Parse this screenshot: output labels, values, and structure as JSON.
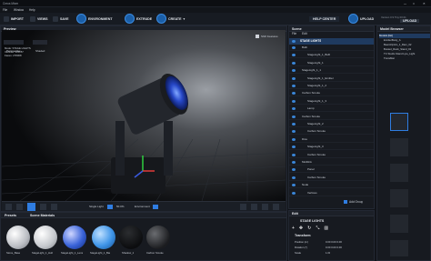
{
  "window": {
    "title": "Creos Mixer",
    "min": "—",
    "max": "□",
    "close": "✕"
  },
  "menu": [
    "File",
    "Window",
    "Help"
  ],
  "toolbar": {
    "import": "IMPORT",
    "views": "VIEWS",
    "save": "SAVE",
    "environment": "ENVIRONMENT",
    "extrude": "EXTRUDE",
    "create": "CREATE",
    "help_center": "HELP CENTER",
    "version": "Version 0.9 Tiny 00.01",
    "user": "UPLOAD",
    "upload": "UPLOAD"
  },
  "preview": {
    "title": "Preview",
    "perspective": "Perspective",
    "shaded": "Shaded",
    "stats": [
      "Mode: STAGE LIGHTS",
      "Vertices: 335157",
      "Faces: 278308"
    ],
    "shift_features": "Shift Features",
    "single_light": "Single Light",
    "percent": "50.0%",
    "environment": "Environment"
  },
  "scene": {
    "title": "Scene",
    "tabs": [
      "File",
      "Edit"
    ],
    "root": "STAGE LIGHTS",
    "items": [
      "Bulb",
      "StageLight_1_Bulb",
      "StageLight_1",
      "StageLight_1_1",
      "StageLight_1_Emitter",
      "StageLight_1_2",
      "Carbon Smoke",
      "StageLight_1_3",
      "Lamp",
      "Carbon Smoke",
      "StageLight_2",
      "Carbon Smoke",
      "Dice",
      "StageLight_3",
      "Carbon Smoke",
      "Multilink",
      "Panel",
      "Carbon Smoke",
      "Node",
      "Vertices"
    ],
    "add_group": "Add Group"
  },
  "model_browser": {
    "title": "Model Browser",
    "items": [
      "Models [list]",
      "EmitterBody_A",
      "BeamOptics_1_Ram_02",
      "Busted_Rack_Stand_02",
      "TC Studio Stand Lyre_Light",
      "TransMat"
    ]
  },
  "bottom": {
    "presets": "Presets",
    "materials": "Scene Materials",
    "swatches": [
      "Stone_Base",
      "StageLight_1_Hull",
      "StageLight_1_Lens",
      "StageLight_1_Bar",
      "Shadow_1",
      "Carbon Smoke"
    ]
  },
  "edit": {
    "title": "Edit",
    "name": "STAGE LIGHTS",
    "section": "Transform",
    "position_label": "Position (m)",
    "position": "0.00  0.00  0.00",
    "rotation_label": "Rotation (°)",
    "rotation": "0.00  0.00  0.00",
    "scale_label": "Scale",
    "scale": "1.00"
  },
  "colors": {
    "accent": "#2f7de1",
    "panel": "#171a20",
    "bg": "#0a0b0d"
  }
}
